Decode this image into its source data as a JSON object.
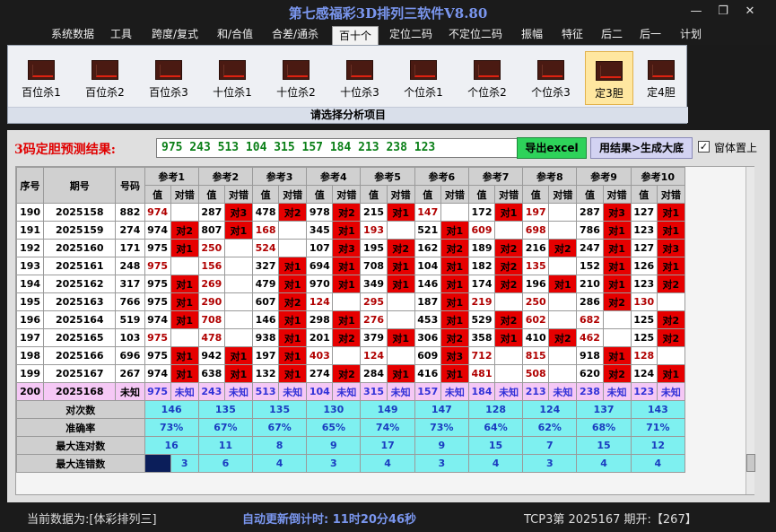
{
  "window": {
    "title": "第七感福彩3D排列三软件V8.80",
    "min": "—",
    "restore": "❐",
    "close": "✕"
  },
  "menu": [
    "系统数据",
    "工具",
    "跨度/复式",
    "和/合值",
    "合差/通杀",
    "百十个",
    "定位二码",
    "不定位二码",
    "振幅",
    "特征",
    "后二",
    "后一",
    "计划"
  ],
  "menu_active": 5,
  "ribbon": {
    "buttons": [
      "百位杀1",
      "百位杀2",
      "百位杀3",
      "十位杀1",
      "十位杀2",
      "十位杀3",
      "个位杀1",
      "个位杀2",
      "个位杀3",
      "定3胆",
      "定4胆"
    ],
    "selected": 9,
    "group_label": "请选择分析项目"
  },
  "prediction": {
    "label": "3码定胆预测结果:",
    "value": "975 243 513 104 315 157 184 213 238 123",
    "export_label": "导出excel",
    "generate_label": "用结果>生成大底",
    "topmost_checked": "✓",
    "topmost_label": "窗体置上"
  },
  "table": {
    "headers": {
      "seq": "序号",
      "period": "期号",
      "number": "号码",
      "refs": [
        "参考1",
        "参考2",
        "参考3",
        "参考4",
        "参考5",
        "参考6",
        "参考7",
        "参考8",
        "参考9",
        "参考10"
      ],
      "value": "值",
      "status": "对错"
    },
    "rows": [
      {
        "seq": "190",
        "period": "2025158",
        "num": "882",
        "cells": [
          [
            "974",
            ""
          ],
          [
            "287",
            "对3"
          ],
          [
            "478",
            "对2"
          ],
          [
            "978",
            "对2"
          ],
          [
            "215",
            "对1"
          ],
          [
            "147",
            ""
          ],
          [
            "172",
            "对1"
          ],
          [
            "197",
            ""
          ],
          [
            "287",
            "对3"
          ],
          [
            "127",
            "对1"
          ]
        ]
      },
      {
        "seq": "191",
        "period": "2025159",
        "num": "274",
        "cells": [
          [
            "974",
            "对2"
          ],
          [
            "807",
            "对1"
          ],
          [
            "168",
            ""
          ],
          [
            "345",
            "对1"
          ],
          [
            "193",
            ""
          ],
          [
            "521",
            "对1"
          ],
          [
            "609",
            ""
          ],
          [
            "698",
            ""
          ],
          [
            "786",
            "对1"
          ],
          [
            "123",
            "对1"
          ]
        ]
      },
      {
        "seq": "192",
        "period": "2025160",
        "num": "171",
        "cells": [
          [
            "975",
            "对1"
          ],
          [
            "250",
            ""
          ],
          [
            "524",
            ""
          ],
          [
            "107",
            "对3"
          ],
          [
            "195",
            "对2"
          ],
          [
            "162",
            "对2"
          ],
          [
            "189",
            "对2"
          ],
          [
            "216",
            "对2"
          ],
          [
            "247",
            "对1"
          ],
          [
            "127",
            "对3"
          ]
        ]
      },
      {
        "seq": "193",
        "period": "2025161",
        "num": "248",
        "cells": [
          [
            "975",
            ""
          ],
          [
            "156",
            ""
          ],
          [
            "327",
            "对1"
          ],
          [
            "694",
            "对1"
          ],
          [
            "708",
            "对1"
          ],
          [
            "104",
            "对1"
          ],
          [
            "182",
            "对2"
          ],
          [
            "135",
            ""
          ],
          [
            "152",
            "对1"
          ],
          [
            "126",
            "对1"
          ]
        ]
      },
      {
        "seq": "194",
        "period": "2025162",
        "num": "317",
        "cells": [
          [
            "975",
            "对1"
          ],
          [
            "269",
            ""
          ],
          [
            "479",
            "对1"
          ],
          [
            "970",
            "对1"
          ],
          [
            "349",
            "对1"
          ],
          [
            "146",
            "对1"
          ],
          [
            "174",
            "对2"
          ],
          [
            "196",
            "对1"
          ],
          [
            "210",
            "对1"
          ],
          [
            "123",
            "对2"
          ]
        ]
      },
      {
        "seq": "195",
        "period": "2025163",
        "num": "766",
        "cells": [
          [
            "975",
            "对1"
          ],
          [
            "290",
            ""
          ],
          [
            "607",
            "对2"
          ],
          [
            "124",
            ""
          ],
          [
            "295",
            ""
          ],
          [
            "187",
            "对1"
          ],
          [
            "219",
            ""
          ],
          [
            "250",
            ""
          ],
          [
            "286",
            "对2"
          ],
          [
            "130",
            ""
          ]
        ]
      },
      {
        "seq": "196",
        "period": "2025164",
        "num": "519",
        "cells": [
          [
            "974",
            "对1"
          ],
          [
            "708",
            ""
          ],
          [
            "146",
            "对1"
          ],
          [
            "298",
            "对1"
          ],
          [
            "276",
            ""
          ],
          [
            "453",
            "对1"
          ],
          [
            "529",
            "对2"
          ],
          [
            "602",
            ""
          ],
          [
            "682",
            ""
          ],
          [
            "125",
            "对2"
          ]
        ]
      },
      {
        "seq": "197",
        "period": "2025165",
        "num": "103",
        "cells": [
          [
            "975",
            ""
          ],
          [
            "478",
            ""
          ],
          [
            "938",
            "对1"
          ],
          [
            "201",
            "对2"
          ],
          [
            "379",
            "对1"
          ],
          [
            "306",
            "对2"
          ],
          [
            "358",
            "对1"
          ],
          [
            "410",
            "对2"
          ],
          [
            "462",
            ""
          ],
          [
            "125",
            "对2"
          ]
        ]
      },
      {
        "seq": "198",
        "period": "2025166",
        "num": "696",
        "cells": [
          [
            "975",
            "对1"
          ],
          [
            "942",
            "对1"
          ],
          [
            "197",
            "对1"
          ],
          [
            "403",
            ""
          ],
          [
            "124",
            ""
          ],
          [
            "609",
            "对3"
          ],
          [
            "712",
            ""
          ],
          [
            "815",
            ""
          ],
          [
            "918",
            "对1"
          ],
          [
            "128",
            ""
          ]
        ]
      },
      {
        "seq": "199",
        "period": "2025167",
        "num": "267",
        "cells": [
          [
            "974",
            "对1"
          ],
          [
            "638",
            "对1"
          ],
          [
            "132",
            "对1"
          ],
          [
            "274",
            "对2"
          ],
          [
            "284",
            "对1"
          ],
          [
            "416",
            "对1"
          ],
          [
            "481",
            ""
          ],
          [
            "508",
            ""
          ],
          [
            "620",
            "对2"
          ],
          [
            "124",
            "对1"
          ]
        ]
      }
    ],
    "prediction_row": {
      "seq": "200",
      "period": "2025168",
      "num": "未知",
      "cells": [
        [
          "975",
          "未知"
        ],
        [
          "243",
          "未知"
        ],
        [
          "513",
          "未知"
        ],
        [
          "104",
          "未知"
        ],
        [
          "315",
          "未知"
        ],
        [
          "157",
          "未知"
        ],
        [
          "184",
          "未知"
        ],
        [
          "213",
          "未知"
        ],
        [
          "238",
          "未知"
        ],
        [
          "123",
          "未知"
        ]
      ]
    },
    "stats": [
      {
        "label": "对次数",
        "values": [
          "146",
          "135",
          "135",
          "130",
          "149",
          "147",
          "128",
          "124",
          "137",
          "143"
        ]
      },
      {
        "label": "准确率",
        "values": [
          "73%",
          "67%",
          "67%",
          "65%",
          "74%",
          "73%",
          "64%",
          "62%",
          "68%",
          "71%"
        ]
      },
      {
        "label": "最大连对数",
        "values": [
          "16",
          "11",
          "8",
          "9",
          "17",
          "9",
          "15",
          "7",
          "15",
          "12"
        ]
      },
      {
        "label": "最大连错数",
        "values": [
          "3",
          "6",
          "4",
          "3",
          "4",
          "3",
          "4",
          "3",
          "4",
          "4"
        ]
      }
    ]
  },
  "status": {
    "left": "当前数据为:[体彩排列三]",
    "mid": "自动更新倒计时: 11时20分46秒",
    "right": "TCP3第 2025167 期开:【267】"
  },
  "colors": {
    "hit": "#e60000",
    "prediction_row": "#f5c8f5",
    "stat_row": "#7ef0f0",
    "title": "#7a96ee",
    "prediction_text": "#0a7f17"
  }
}
